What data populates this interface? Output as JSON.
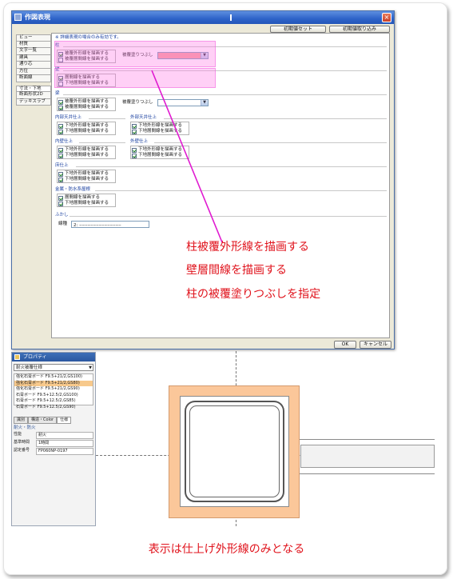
{
  "dialog": {
    "title": "作図表現",
    "close": "×",
    "btn_init_set": "初期値セット",
    "btn_init_load": "初期値取り込み",
    "btn_ok": "OK",
    "btn_cancel": "キャンセル",
    "note": "※ 詳細表現の場合のみ有効です。"
  },
  "nav": [
    "ビュー",
    "材質",
    "文字一覧",
    "建具",
    "通り芯",
    "方位",
    "断面線",
    "寸法・下地",
    "断面形状2D",
    "デッキスラブ"
  ],
  "sections": {
    "pillar": {
      "title": "柱",
      "c1": "被覆外形線を描画する",
      "c2": "被覆層間線を描画する",
      "fill_label": "被覆塗りつぶし"
    },
    "wall": {
      "title": "壁",
      "c1": "層間線を描画する",
      "c2": "下地層間線を描画する"
    },
    "beam": {
      "title": "梁",
      "c1": "被覆外形線を描画する",
      "c2": "被覆層間線を描画する",
      "fill_label": "被覆塗りつぶし"
    },
    "inner_ceiling": {
      "title": "内部天井仕上",
      "c1": "下地外形線を描画する",
      "c2": "下地層間線を描画する"
    },
    "outer_ceiling": {
      "title": "外部天井仕上",
      "c1": "下地外形線を描画する",
      "c2": "下地層間線を描画する"
    },
    "inner_wall": {
      "title": "内壁仕上",
      "c1": "下地外形線を描画する",
      "c2": "下地層間線を描画する"
    },
    "outer_wall": {
      "title": "外壁仕上",
      "c1": "下地外形線を描画する",
      "c2": "下地層間線を描画する"
    },
    "floor": {
      "title": "床仕上",
      "c1": "下地外形線を描画する",
      "c2": "下地層間線を描画する"
    },
    "metal_roof": {
      "title": "金属・防水系屋根",
      "c1": "層間線を描画する",
      "c2": "下地層間線を描画する"
    },
    "fukashi": {
      "title": "ふかし",
      "line_label": "線種",
      "line_value": "2: ‒‒‒‒‒‒‒‒‒‒‒‒‒‒‒"
    }
  },
  "annotations": [
    "柱被覆外形線を描画する",
    "壁層間線を描画する",
    "柱の被覆塗りつぶしを指定"
  ],
  "footer": "表示は仕上げ外形線のみとなる",
  "property": {
    "title": "プロパティ",
    "selected": "耐火被覆仕様",
    "list": [
      "強化石膏ボード F9.5+21/2,GS100)",
      "強化石膏ボード F9.5+21/2,GS80)",
      "強化石膏ボード F9.5+21/2,GS90)",
      "石膏ボード F9.5+12.5/2,GS100)",
      "石膏ボード F9.5+12.5/2,GS85)",
      "石膏ボード F9.5+12.5/2,GS90)"
    ],
    "tabs": [
      "識別",
      "構造・Color",
      "仕様"
    ],
    "category": "耐火・防火",
    "rows": [
      {
        "k": "性能",
        "v": "耐火"
      },
      {
        "k": "基準時間",
        "v": "1時間"
      },
      {
        "k": "認定番号",
        "v": "FP060NP-0197"
      }
    ]
  },
  "colors": {
    "accent": "#e0131c",
    "highlight": "#ff78e6",
    "cover": "#fbc79a",
    "titlebar": "#2e63c8"
  }
}
